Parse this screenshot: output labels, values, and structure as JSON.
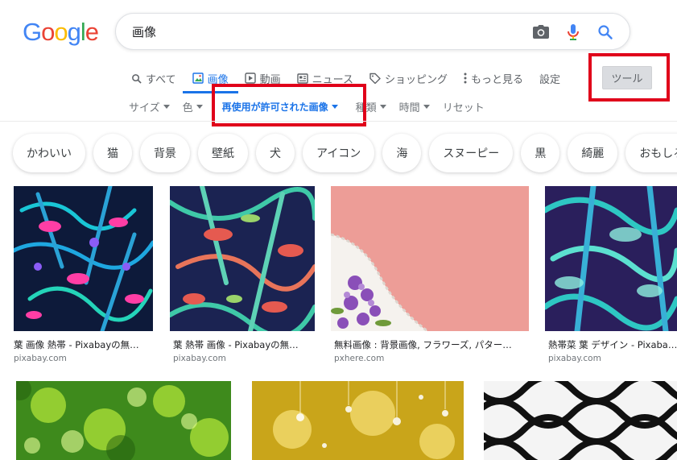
{
  "search": {
    "query": "画像"
  },
  "tabs": [
    {
      "label": "すべて",
      "icon": "search-icon"
    },
    {
      "label": "画像",
      "icon": "image-icon"
    },
    {
      "label": "動画",
      "icon": "video-icon"
    },
    {
      "label": "ニュース",
      "icon": "news-icon"
    },
    {
      "label": "ショッピング",
      "icon": "tag-icon"
    },
    {
      "label": "もっと見る",
      "icon": "more-vert-icon"
    },
    {
      "label": "設定"
    }
  ],
  "tools_label": "ツール",
  "filters": {
    "size": "サイズ",
    "color": "色",
    "license": "再使用が許可された画像",
    "type": "種類",
    "time": "時間",
    "reset": "リセット"
  },
  "chips": [
    "かわいい",
    "猫",
    "背景",
    "壁紙",
    "犬",
    "アイコン",
    "海",
    "スヌーピー",
    "黒",
    "綺麗",
    "おもしろ"
  ],
  "results": [
    {
      "caption": "葉 画像 熱帯 - Pixabayの無…",
      "domain": "pixabay.com"
    },
    {
      "caption": "葉 熱帯 画像 - Pixabayの無…",
      "domain": "pixabay.com"
    },
    {
      "caption": "無料画像 : 背景画像, フラワーズ, パター…",
      "domain": "pxhere.com"
    },
    {
      "caption": "熱帯菜 葉 デザイン - Pixaba…",
      "domain": "pixabay.com"
    }
  ],
  "colors": {
    "accent": "#1a73e8",
    "highlight": "#e0001a"
  }
}
